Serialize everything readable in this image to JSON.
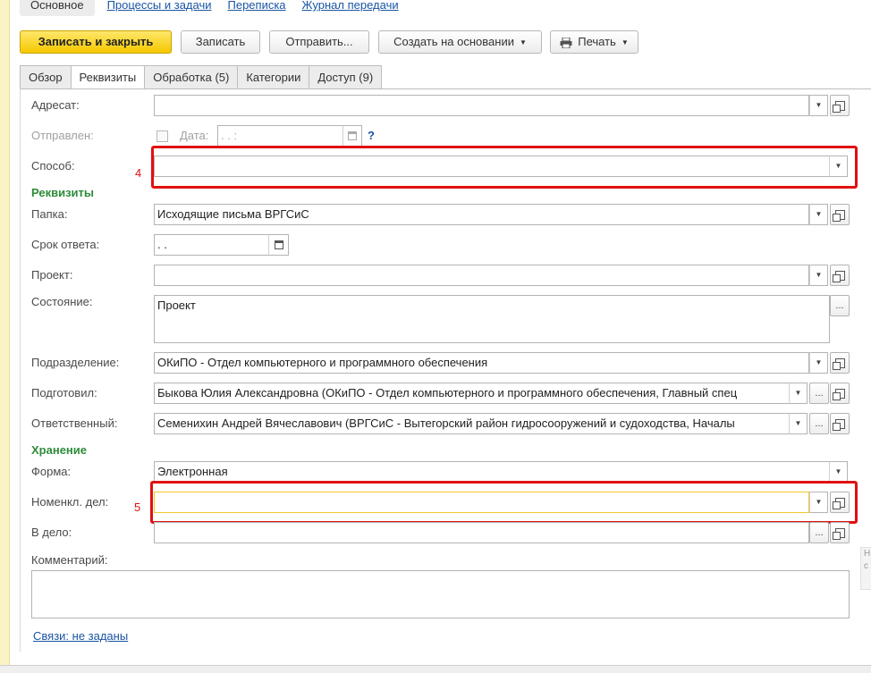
{
  "top_nav": {
    "active": "Основное",
    "links": [
      "Процессы и задачи",
      "Переписка",
      "Журнал передачи"
    ]
  },
  "toolbar": {
    "save_close": "Записать и закрыть",
    "save": "Записать",
    "send": "Отправить...",
    "create_based": "Создать на основании",
    "print": "Печать"
  },
  "tabs": [
    "Обзор",
    "Реквизиты",
    "Обработка (5)",
    "Категории",
    "Доступ (9)"
  ],
  "form": {
    "addressee_label": "Адресат:",
    "sent_label": "Отправлен:",
    "date_label": "Дата:",
    "date_placeholder": " .  .        :",
    "help_mark": "?",
    "method_label": "Способ:",
    "section_requisites": "Реквизиты",
    "folder_label": "Папка:",
    "folder_value": "Исходящие письма ВРГСиС",
    "due_label": "Срок ответа:",
    "due_value": " .  .",
    "project_label": "Проект:",
    "state_label": "Состояние:",
    "state_value": "Проект",
    "department_label": "Подразделение:",
    "department_value": "ОКиПО - Отдел компьютерного и программного обеспечения",
    "prepared_label": "Подготовил:",
    "prepared_value": "Быкова Юлия Александровна (ОКиПО - Отдел компьютерного и программного обеспечения, Главный спец",
    "responsible_label": "Ответственный:",
    "responsible_value": "Семенихин Андрей Вячеславович (ВРГСиС - Вытегорский район гидросооружений и судоходства, Началы",
    "section_storage": "Хранение",
    "form_label": "Форма:",
    "form_value": "Электронная",
    "nomenclature_label": "Номенкл. дел:",
    "case_label": "В дело:",
    "comment_label": "Комментарий:",
    "links_text": "Связи: не заданы"
  },
  "annotations": [
    "4",
    "5"
  ],
  "right_edge_text": "Н с",
  "icons": {
    "dropdown": "chevron-down-icon",
    "open": "open-form-icon",
    "calendar": "calendar-icon",
    "more": "..."
  }
}
